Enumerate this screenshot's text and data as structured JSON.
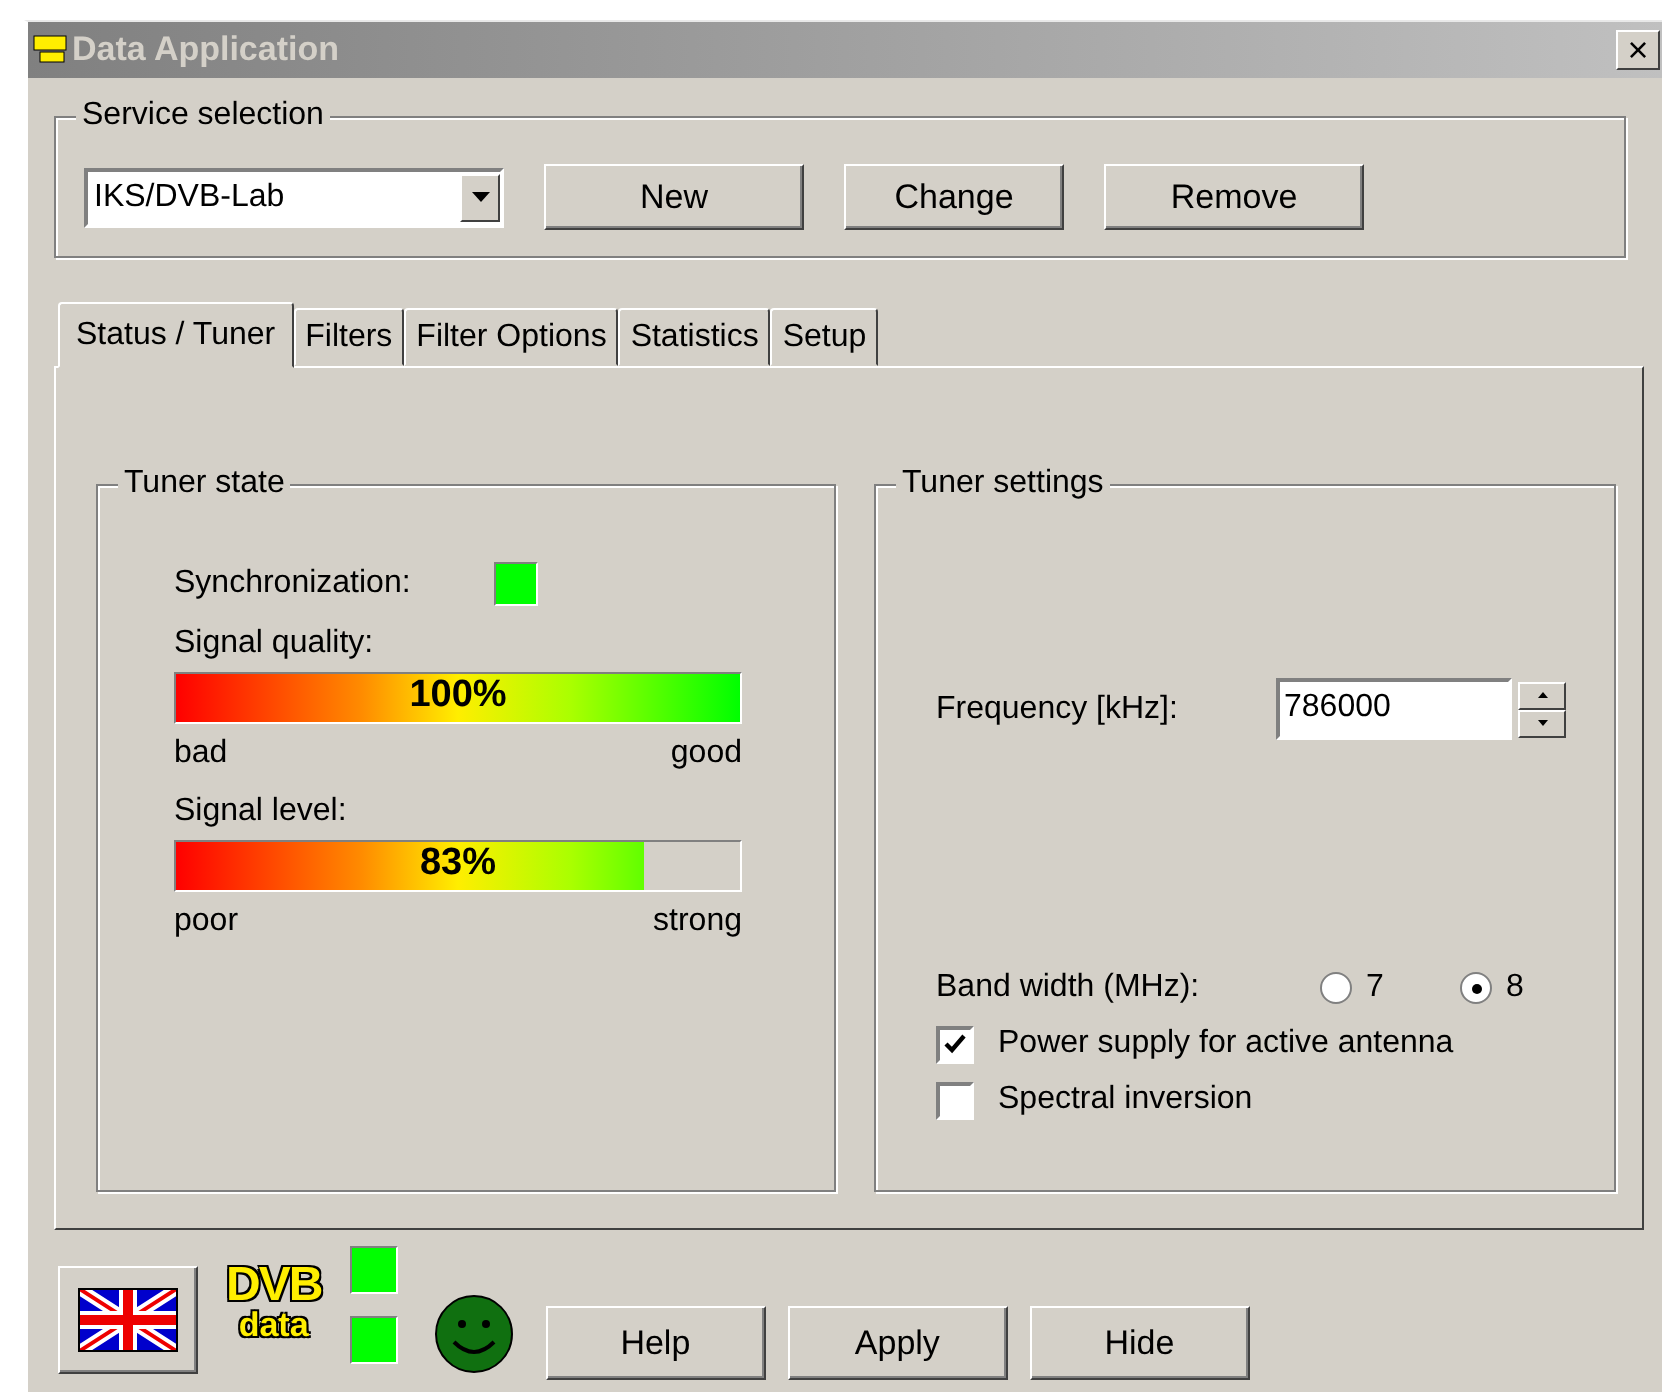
{
  "window": {
    "title": "Data Application",
    "close": "×"
  },
  "service_selection": {
    "label": "Service selection",
    "selected_service": "IKS/DVB-Lab",
    "buttons": [
      "New",
      "Change",
      "Remove"
    ]
  },
  "tabs": [
    {
      "label": "Status / Tuner",
      "selected": true
    },
    {
      "label": "Filters",
      "selected": false
    },
    {
      "label": "Filter Options",
      "selected": false
    },
    {
      "label": "Statistics",
      "selected": false
    },
    {
      "label": "Setup",
      "selected": false
    }
  ],
  "tuner_state": {
    "label": "Tuner state",
    "sync_label": "Synchronization:",
    "sync_on": true,
    "meters": [
      {
        "label": "Signal quality:",
        "level": 1.0,
        "reading": "100%",
        "low": "bad",
        "high": "good"
      },
      {
        "label": "Signal level:",
        "level": 0.83,
        "reading": "83%",
        "low": "poor",
        "high": "strong"
      }
    ]
  },
  "tuner_settings": {
    "label": "Tuner settings",
    "frequency_label": "Frequency [kHz]:",
    "frequency": "786000",
    "bandwidth_label": "Band width (MHz):",
    "bandwidth_options": [
      {
        "label": "7",
        "selected": false
      },
      {
        "label": "8",
        "selected": true
      }
    ],
    "checkboxes": [
      {
        "label": "Power supply for active antenna",
        "checked": true
      },
      {
        "label": "Spectral inversion",
        "checked": false
      }
    ]
  },
  "footer": {
    "logo_top": "DVB",
    "logo_bottom": "data",
    "indicators": [
      {
        "on": true
      },
      {
        "on": true
      }
    ],
    "status_ok": true,
    "buttons": [
      "Help",
      "Apply",
      "Hide"
    ]
  }
}
